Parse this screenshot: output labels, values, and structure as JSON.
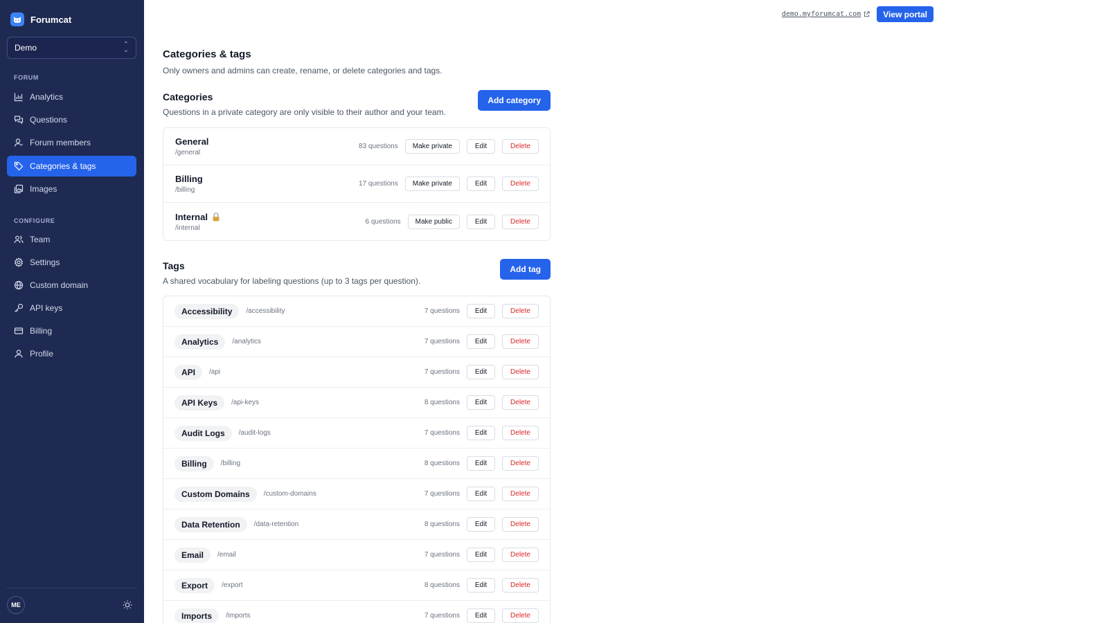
{
  "app": {
    "name": "Forumcat",
    "workspace": "Demo"
  },
  "sidebar": {
    "forum_label": "FORUM",
    "forum_items": [
      {
        "label": "Analytics",
        "icon": "chart-icon"
      },
      {
        "label": "Questions",
        "icon": "chat-bubbles-icon"
      },
      {
        "label": "Forum members",
        "icon": "user-icon"
      },
      {
        "label": "Categories & tags",
        "icon": "tag-icon",
        "active": true
      },
      {
        "label": "Images",
        "icon": "images-icon"
      }
    ],
    "configure_label": "CONFIGURE",
    "configure_items": [
      {
        "label": "Team",
        "icon": "team-icon"
      },
      {
        "label": "Settings",
        "icon": "gear-icon"
      },
      {
        "label": "Custom domain",
        "icon": "globe-icon"
      },
      {
        "label": "API keys",
        "icon": "key-icon"
      },
      {
        "label": "Billing",
        "icon": "credit-card-icon"
      },
      {
        "label": "Profile",
        "icon": "profile-icon"
      }
    ],
    "avatar_initials": "ME"
  },
  "topbar": {
    "domain": "demo.myforumcat.com",
    "view_portal": "View portal"
  },
  "page": {
    "title": "Categories & tags",
    "description": "Only owners and admins can create, rename, or delete categories and tags."
  },
  "categories": {
    "title": "Categories",
    "description": "Questions in a private category are only visible to their author and your team.",
    "add_label": "Add category",
    "items": [
      {
        "name": "General",
        "slug": "/general",
        "count": "83 questions",
        "privacy_label": "Make private",
        "locked": false
      },
      {
        "name": "Billing",
        "slug": "/billing",
        "count": "17 questions",
        "privacy_label": "Make private",
        "locked": false
      },
      {
        "name": "Internal",
        "slug": "/internal",
        "count": "6 questions",
        "privacy_label": "Make public",
        "locked": true
      }
    ]
  },
  "tags": {
    "title": "Tags",
    "description": "A shared vocabulary for labeling questions (up to 3 tags per question).",
    "add_label": "Add tag",
    "items": [
      {
        "name": "Accessibility",
        "slug": "/accessibility",
        "count": "7 questions"
      },
      {
        "name": "Analytics",
        "slug": "/analytics",
        "count": "7 questions"
      },
      {
        "name": "API",
        "slug": "/api",
        "count": "7 questions"
      },
      {
        "name": "API Keys",
        "slug": "/api-keys",
        "count": "8 questions"
      },
      {
        "name": "Audit Logs",
        "slug": "/audit-logs",
        "count": "7 questions"
      },
      {
        "name": "Billing",
        "slug": "/billing",
        "count": "8 questions"
      },
      {
        "name": "Custom Domains",
        "slug": "/custom-domains",
        "count": "7 questions"
      },
      {
        "name": "Data Retention",
        "slug": "/data-retention",
        "count": "8 questions"
      },
      {
        "name": "Email",
        "slug": "/email",
        "count": "7 questions"
      },
      {
        "name": "Export",
        "slug": "/export",
        "count": "8 questions"
      },
      {
        "name": "Imports",
        "slug": "/imports",
        "count": "7 questions"
      }
    ]
  },
  "actions": {
    "edit": "Edit",
    "delete": "Delete"
  },
  "colors": {
    "sidebar": "#1e2a52",
    "accent": "#2563eb",
    "danger": "#dc2626"
  }
}
